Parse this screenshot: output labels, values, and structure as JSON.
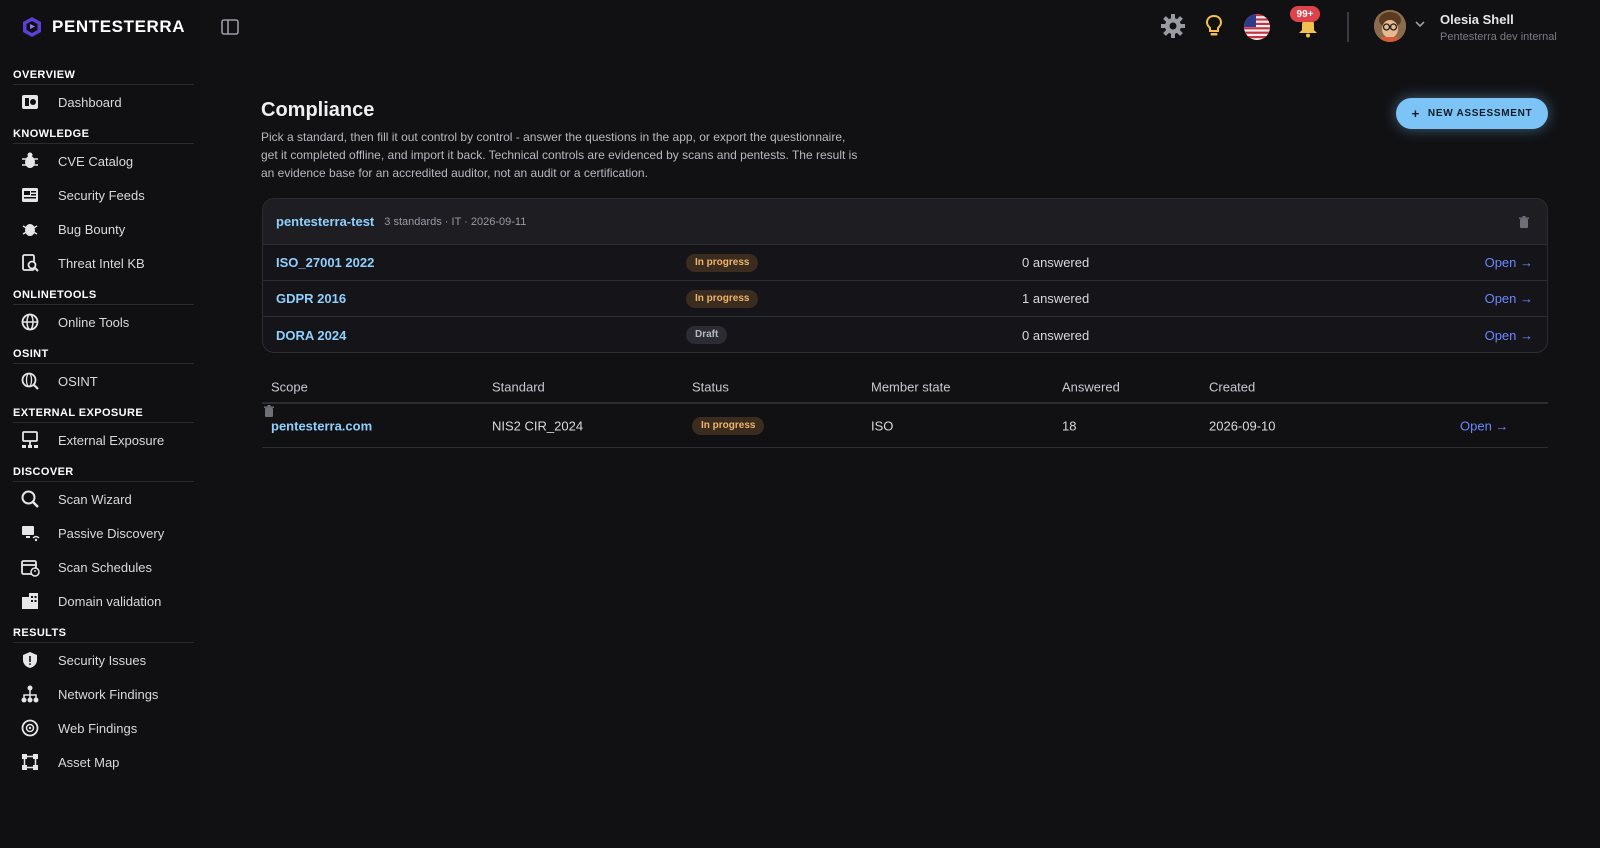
{
  "brand": {
    "name": "PENTESTERRA"
  },
  "user": {
    "name": "Olesia Shell",
    "org": "Pentesterra dev internal"
  },
  "notifications": {
    "badge": "99+"
  },
  "sidebar": {
    "sections": [
      {
        "title": "OVERVIEW",
        "items": [
          {
            "label": "Dashboard",
            "icon": "dashboard-icon"
          }
        ]
      },
      {
        "title": "KNOWLEDGE",
        "items": [
          {
            "label": "CVE Catalog",
            "icon": "bug-icon"
          },
          {
            "label": "Security Feeds",
            "icon": "news-icon"
          },
          {
            "label": "Bug Bounty",
            "icon": "bug-icon"
          },
          {
            "label": "Threat Intel KB",
            "icon": "document-search-icon"
          }
        ]
      },
      {
        "title": "ONLINETOOLS",
        "items": [
          {
            "label": "Online Tools",
            "icon": "globe-icon"
          }
        ]
      },
      {
        "title": "OSINT",
        "items": [
          {
            "label": "OSINT",
            "icon": "globe-search-icon"
          }
        ]
      },
      {
        "title": "EXTERNAL EXPOSURE",
        "items": [
          {
            "label": "External Exposure",
            "icon": "network-icon"
          }
        ]
      },
      {
        "title": "DISCOVER",
        "items": [
          {
            "label": "Scan Wizard",
            "icon": "search-icon"
          },
          {
            "label": "Passive Discovery",
            "icon": "monitor-wifi-icon"
          },
          {
            "label": "Scan Schedules",
            "icon": "calendar-icon"
          },
          {
            "label": "Domain validation",
            "icon": "building-icon"
          }
        ]
      },
      {
        "title": "RESULTS",
        "items": [
          {
            "label": "Security Issues",
            "icon": "shield-icon"
          },
          {
            "label": "Network Findings",
            "icon": "hierarchy-icon"
          },
          {
            "label": "Web Findings",
            "icon": "web-icon"
          },
          {
            "label": "Asset Map",
            "icon": "map-icon"
          }
        ]
      }
    ]
  },
  "page": {
    "title": "Compliance",
    "description": "Pick a standard, then fill it out control by control - answer the questions in the app, or export the questionnaire, get it completed offline, and import it back. Technical controls are evidenced by scans and pentests. The result is an evidence base for an accredited auditor, not an audit or a certification.",
    "new_button": "NEW ASSESSMENT",
    "new_button_icon": "+"
  },
  "card": {
    "title": "pentesterra-test",
    "meta": "3 standards · IT · 2026-09-11",
    "rows": [
      {
        "name": "ISO_27001 2022",
        "status": "In progress",
        "status_kind": "progress",
        "answered": "0 answered",
        "open": "Open →"
      },
      {
        "name": "GDPR 2016",
        "status": "In progress",
        "status_kind": "progress",
        "answered": "1 answered",
        "open": "Open →"
      },
      {
        "name": "DORA 2024",
        "status": "Draft",
        "status_kind": "draft",
        "answered": "0 answered",
        "open": "Open →"
      }
    ]
  },
  "table": {
    "headers": {
      "scope": "Scope",
      "standard": "Standard",
      "status": "Status",
      "member_state": "Member state",
      "answered": "Answered",
      "created": "Created"
    },
    "rows": [
      {
        "scope": "pentesterra.com",
        "standard": "NIS2 CIR_2024",
        "status": "In progress",
        "member_state": "ISO",
        "answered": "18",
        "created": "2026-09-10",
        "open": "Open →"
      }
    ]
  },
  "colors": {
    "accent": "#7cc4f5",
    "link": "#8fd0ff",
    "open_link": "#6c86ff",
    "badge": "#e0424b"
  }
}
